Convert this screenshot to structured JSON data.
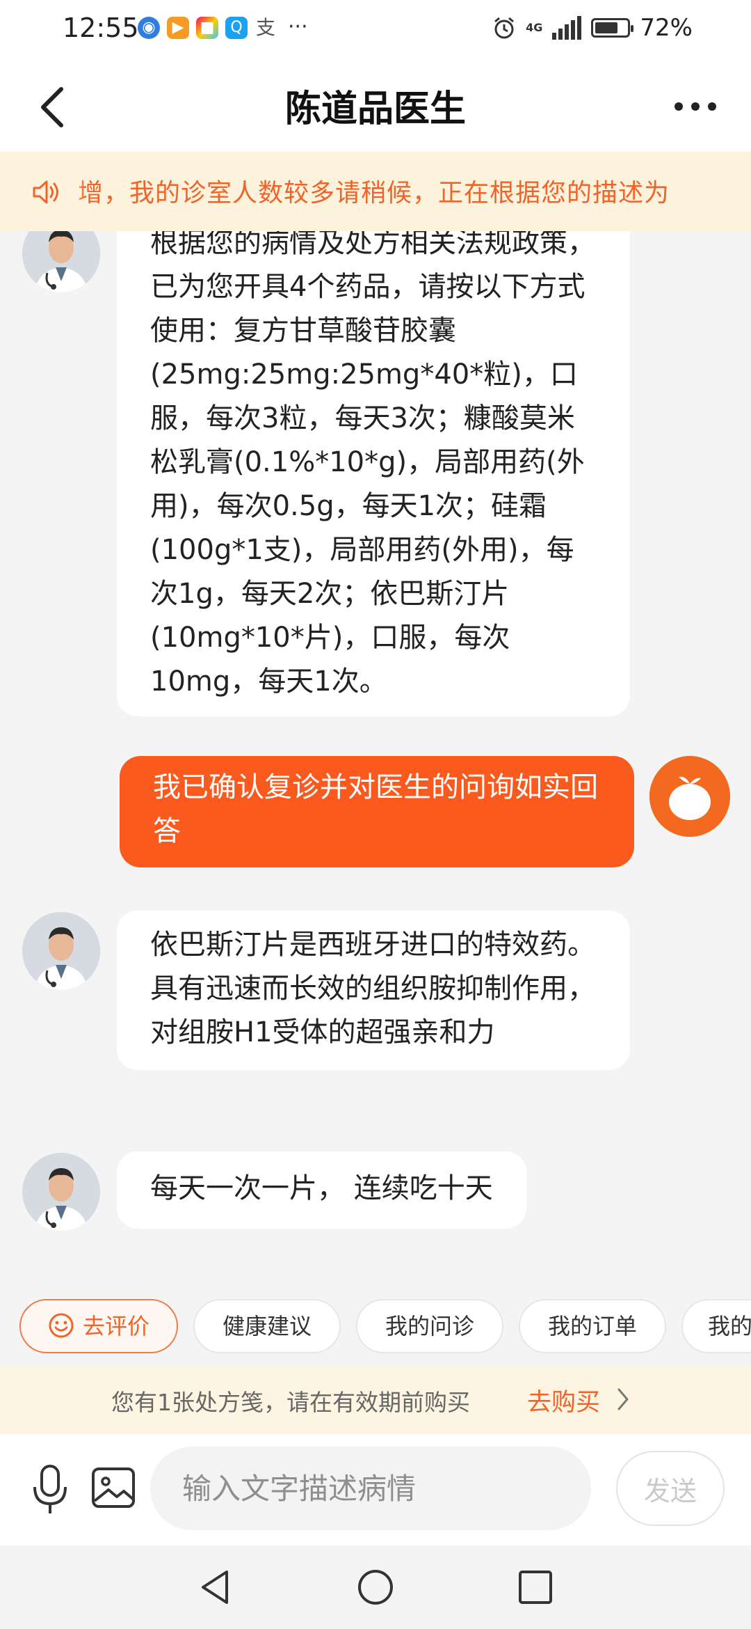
{
  "status_bar": {
    "time": "12:55",
    "battery": "72%",
    "battery_level": 0.72,
    "network": "4G",
    "overflow": "···"
  },
  "header": {
    "title": "陈道品医生"
  },
  "notice": {
    "text": "增，我的诊室人数较多请稍候，正在根据您的描述为"
  },
  "messages": [
    {
      "from": "doctor",
      "text": "根据您的病情及处方相关法规政策，已为您开具4个药品，请按以下方式使用：复方甘草酸苷胶囊(25mg:25mg:25mg*40*粒)，口服，每次3粒，每天3次；糠酸莫米松乳膏(0.1%*10*g)，局部用药(外用)，每次0.5g，每天1次；硅霜(100g*1支)，局部用药(外用)，每次1g，每天2次；依巴斯汀片(10mg*10*片)，口服，每次10mg，每天1次。"
    },
    {
      "from": "user",
      "text": "我已确认复诊并对医生的问询如实回答"
    },
    {
      "from": "doctor",
      "text": "依巴斯汀片是西班牙进口的特效药。具有迅速而长效的组织胺抑制作用，对组胺H1受体的超强亲和力"
    },
    {
      "from": "doctor",
      "text": "每天一次一片， 连续吃十天"
    }
  ],
  "quick_actions": [
    {
      "label": "去评价",
      "icon": "smile-icon"
    },
    {
      "label": "健康建议"
    },
    {
      "label": "我的问诊"
    },
    {
      "label": "我的订单"
    },
    {
      "label": "我的"
    }
  ],
  "prescription_bar": {
    "text": "您有1张处方笺，请在有效期前购买",
    "action": "去购买"
  },
  "input_bar": {
    "placeholder": "输入文字描述病情",
    "send_label": "发送"
  },
  "colors": {
    "accent": "#fa5a1e",
    "notice_bg": "#fdf3dc",
    "notice_text": "#f0642a"
  }
}
